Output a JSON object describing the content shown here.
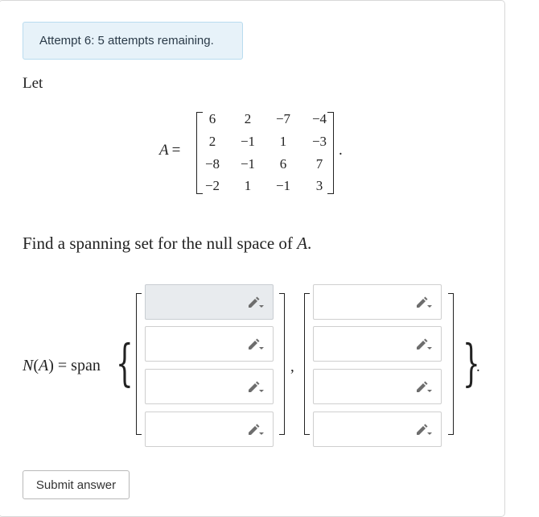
{
  "alert": {
    "text": "Attempt 6: 5 attempts remaining."
  },
  "problem": {
    "let": "Let",
    "matrix_name": "A",
    "equals": "=",
    "matrix": [
      [
        "6",
        "2",
        "−7",
        "−4"
      ],
      [
        "2",
        "−1",
        "1",
        "−3"
      ],
      [
        "−8",
        "−1",
        "6",
        "7"
      ],
      [
        "−2",
        "1",
        "−1",
        "3"
      ]
    ],
    "period": ".",
    "question_text": "Find a spanning set for the null space of ",
    "question_var": "A",
    "question_end": "."
  },
  "answer": {
    "label_n": "N",
    "label_paren_open": "(",
    "label_var": "A",
    "label_paren_close": ")",
    "label_rest": " = span",
    "vectors": [
      {
        "entries": [
          "",
          "",
          "",
          ""
        ]
      },
      {
        "entries": [
          "",
          "",
          "",
          ""
        ]
      }
    ],
    "separator": ",",
    "end": "."
  },
  "submit": {
    "label": "Submit answer"
  },
  "icons": {
    "input_edit": "pencil-dropdown-icon"
  }
}
